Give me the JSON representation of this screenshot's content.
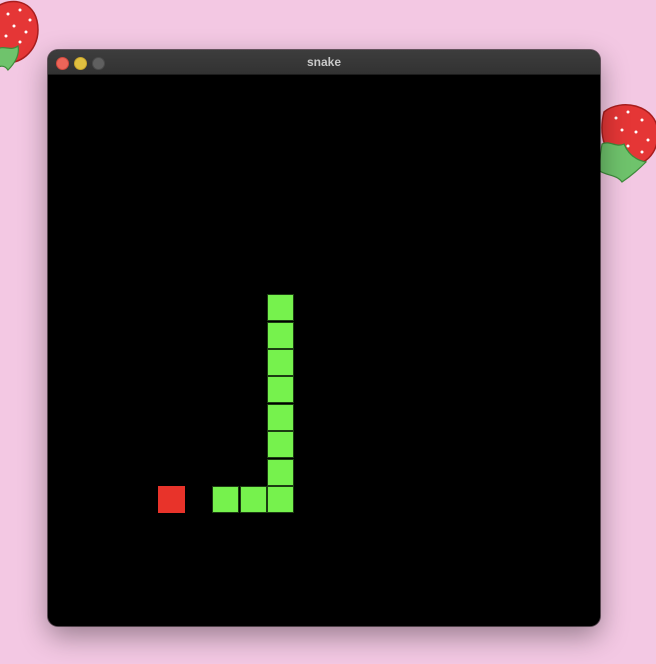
{
  "window": {
    "title": "snake",
    "controls": {
      "close": "close-button",
      "minimize": "minimize-button",
      "zoom": "zoom-button"
    }
  },
  "game": {
    "background_color": "#000000",
    "snake_color": "#76f24d",
    "food_color": "#e8332a",
    "snake_cells": [
      {
        "col": 8,
        "row": 8
      },
      {
        "col": 8,
        "row": 9
      },
      {
        "col": 8,
        "row": 10
      },
      {
        "col": 8,
        "row": 11
      },
      {
        "col": 8,
        "row": 12
      },
      {
        "col": 8,
        "row": 13
      },
      {
        "col": 8,
        "row": 14
      },
      {
        "col": 8,
        "row": 15
      },
      {
        "col": 7,
        "row": 15
      },
      {
        "col": 6,
        "row": 15
      }
    ],
    "food": {
      "col": 4,
      "row": 15
    }
  },
  "desktop": {
    "background_color": "#f3c8e3",
    "decorations": [
      "strawberry-sticker",
      "strawberry-sticker"
    ]
  }
}
